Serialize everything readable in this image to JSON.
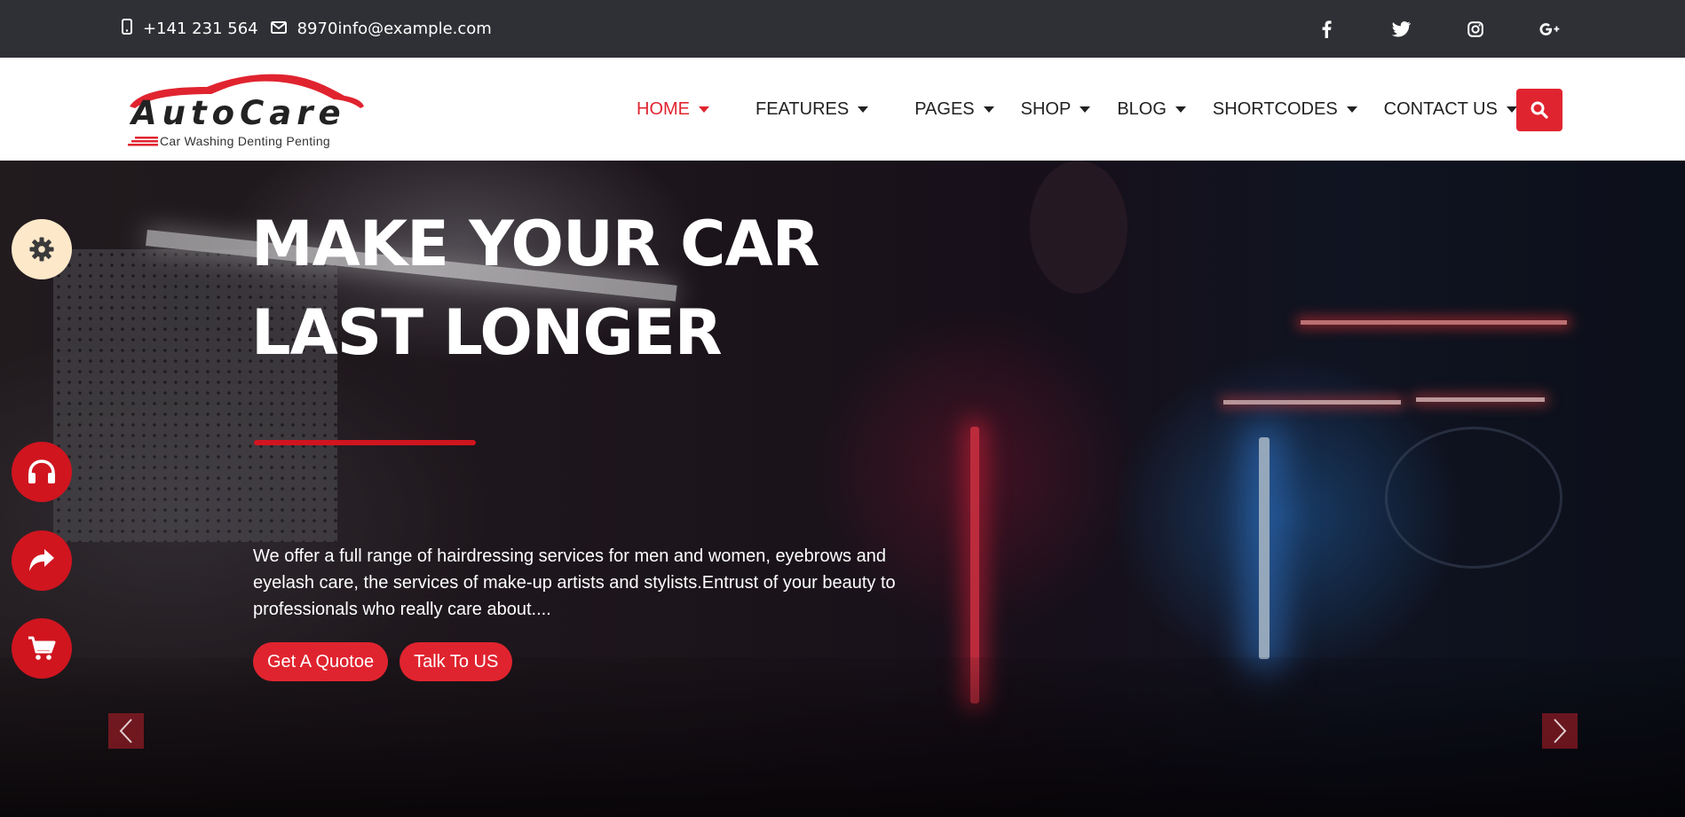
{
  "topbar": {
    "phone": "+141 231 564",
    "email": "8970info@example.com",
    "social": [
      "facebook-icon",
      "twitter-icon",
      "instagram-icon",
      "google-plus-icon"
    ]
  },
  "logo": {
    "name": "AutoCare",
    "tagline": "Car Washing Denting Penting"
  },
  "nav": {
    "items": [
      {
        "label": "HOME",
        "active": true
      },
      {
        "label": "FEATURES",
        "active": false
      },
      {
        "label": "PAGES",
        "active": false
      },
      {
        "label": "SHOP",
        "active": false
      },
      {
        "label": "BLOG",
        "active": false
      },
      {
        "label": "SHORTCODES",
        "active": false
      },
      {
        "label": "CONTACT US",
        "active": false
      }
    ],
    "search_icon": "search-icon"
  },
  "hero": {
    "title_line1": "MAKE YOUR CAR",
    "title_line2": "LAST LONGER",
    "description": "We offer a full range of hairdressing services for men and women, eyebrows and eyelash care, the services of make-up artists and stylists.Entrust of your beauty to professionals who really care about....",
    "primary_button": "Get A Quotoe",
    "secondary_button": "Talk To US"
  },
  "side_buttons": [
    "gear-icon",
    "headphones-icon",
    "share-icon",
    "cart-icon"
  ],
  "colors": {
    "accent": "#e0242f",
    "topbar_bg": "#2e3035",
    "settings_bg": "#fde8c9"
  }
}
